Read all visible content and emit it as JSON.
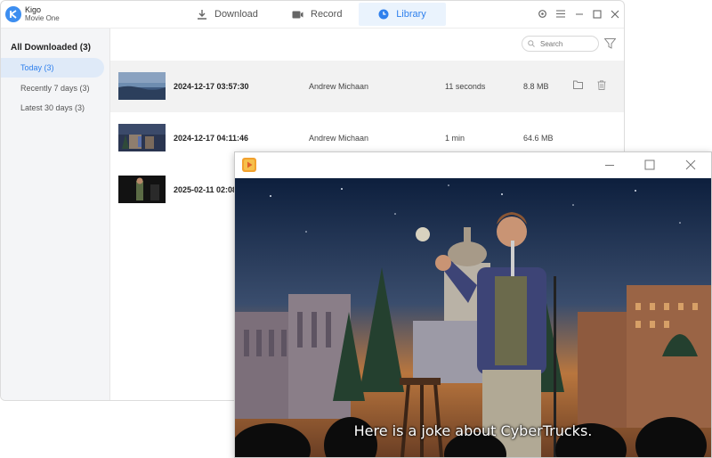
{
  "app": {
    "brand_line1": "Kigo",
    "brand_line2": "Movie One",
    "tabs": [
      {
        "label": "Download",
        "icon": "download-icon"
      },
      {
        "label": "Record",
        "icon": "camera-icon"
      },
      {
        "label": "Library",
        "icon": "clock-icon",
        "active": true
      }
    ],
    "accent": "#2f80ed"
  },
  "sidebar": {
    "header": "All Downloaded (3)",
    "items": [
      {
        "label": "Today (3)",
        "active": true
      },
      {
        "label": "Recently 7 days (3)"
      },
      {
        "label": "Latest 30 days (3)"
      }
    ]
  },
  "search": {
    "placeholder": "Search"
  },
  "library": {
    "rows": [
      {
        "date": "2024-12-17 03:57:30",
        "author": "Andrew Michaan",
        "duration": "11 seconds",
        "size": "8.8 MB"
      },
      {
        "date": "2024-12-17 04:11:46",
        "author": "Andrew Michaan",
        "duration": "1 min",
        "size": "64.6 MB"
      },
      {
        "date": "2025-02-11 02:08",
        "author": "",
        "duration": "",
        "size": ""
      }
    ]
  },
  "player": {
    "subtitle": "Here is a joke about CyberTrucks."
  }
}
